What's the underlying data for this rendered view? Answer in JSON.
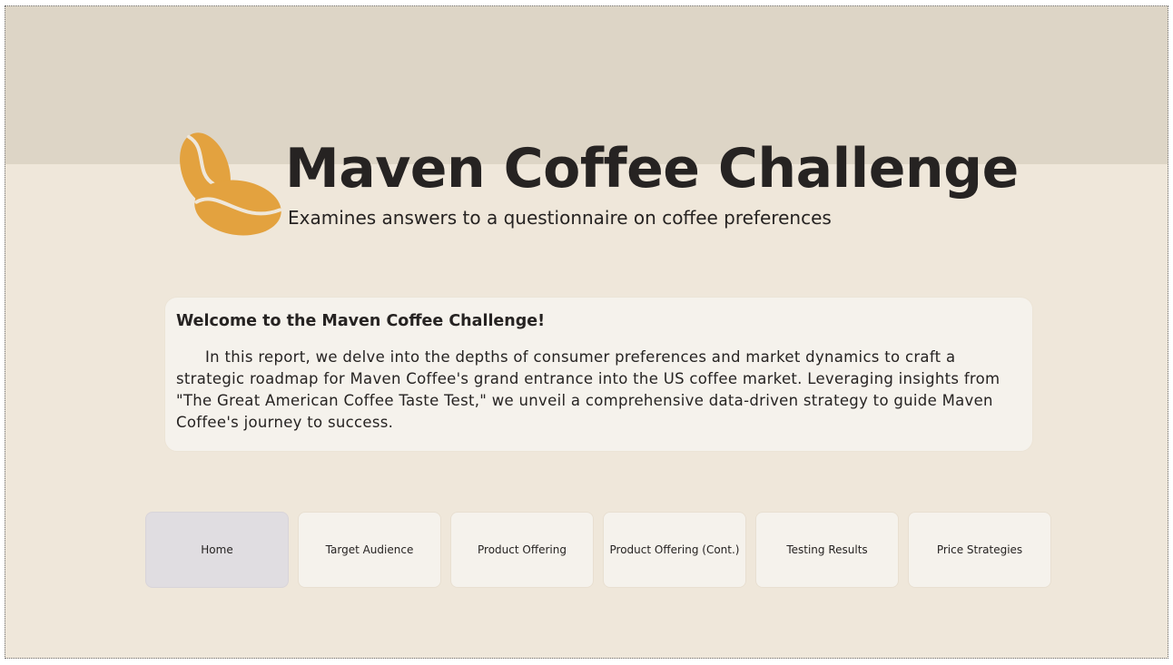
{
  "header": {
    "title": "Maven Coffee Challenge",
    "subtitle": "Examines answers to a questionnaire on coffee preferences",
    "logo_icon": "coffee-bean-icon",
    "logo_color": "#e3a23f"
  },
  "intro": {
    "heading": "Welcome to the Maven Coffee Challenge!",
    "body": "In this report, we delve into the depths of consumer preferences and market dynamics to craft a strategic roadmap for Maven Coffee's grand entrance into the US coffee market. Leveraging insights from \"The Great American Coffee Taste Test,\" we unveil a comprehensive data-driven strategy to guide Maven Coffee's journey to success."
  },
  "nav": {
    "active": "Home",
    "items": [
      {
        "label": "Home"
      },
      {
        "label": "Target Audience"
      },
      {
        "label": "Product Offering"
      },
      {
        "label": "Product Offering (Cont.)"
      },
      {
        "label": "Testing Results"
      },
      {
        "label": "Price Strategies"
      }
    ]
  },
  "colors": {
    "background": "#efe7da",
    "top_band": "#ddd5c6",
    "card": "#f5f2ec",
    "active_button": "#e0dde1",
    "text": "#262322"
  }
}
